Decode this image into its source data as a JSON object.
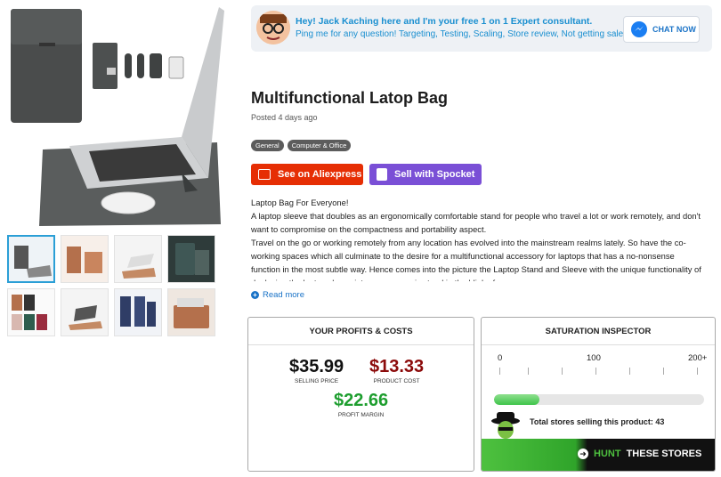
{
  "consultant": {
    "line1": "Hey! Jack Kaching here and I'm your free 1 on 1 Expert consultant.",
    "line2": "Ping me for any question! Targeting, Testing, Scaling, Store review, Not getting sales?",
    "chat_label": "CHAT NOW",
    "avatar_icon": "consultant-avatar",
    "chat_icon": "messenger-icon"
  },
  "product": {
    "title": "Multifunctional Latop Bag",
    "posted": "Posted 4 days ago",
    "tags": [
      "General",
      "Computer & Office"
    ],
    "aliexpress_label": "See on Aliexpress",
    "spocket_label": "Sell with Spocket",
    "description": [
      "Laptop Bag For Everyone!",
      "A laptop sleeve that doubles as an ergonomically comfortable stand for people who travel a lot or work remotely, and don't want to compromise on the compactness and portability aspect.",
      "Travel on the go or working remotely from any location has evolved into the mainstream realms lately. So have the co-working spaces which all culminate to the desire for a multifunctional accessory for laptops that has a no-nonsense function in the most subtle way. Hence comes into the picture the Laptop Stand and Sleeve with the unique functionality of deploying the laptop sleeve into an ergonomic stand in the blink of an eye."
    ],
    "read_more": "Read more",
    "thumbnail_count": 8
  },
  "profits": {
    "header": "YOUR PROFITS & COSTS",
    "selling_price": "$35.99",
    "selling_price_label": "SELLING PRICE",
    "product_cost": "$13.33",
    "product_cost_label": "PRODUCT COST",
    "profit_margin": "$22.66",
    "profit_margin_label": "PROFIT MARGIN",
    "colors": {
      "selling": "#111111",
      "cost": "#8b0a0a",
      "profit": "#1e9e2f"
    }
  },
  "saturation": {
    "header": "SATURATION INSPECTOR",
    "scale": [
      "0",
      "100",
      "200+"
    ],
    "level_fraction": 0.215,
    "total_text": "Total stores selling this product: 43",
    "hunt_part1": "HUNT",
    "hunt_part2": "THESE STORES"
  }
}
